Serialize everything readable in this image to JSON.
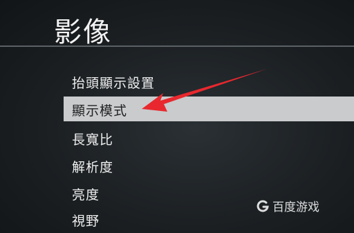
{
  "header": {
    "title": "影像"
  },
  "menu": {
    "items": [
      {
        "label": "抬頭顯示設置",
        "selected": false
      },
      {
        "label": "顯示模式",
        "selected": true
      },
      {
        "label": "長寬比",
        "selected": false
      },
      {
        "label": "解析度",
        "selected": false
      },
      {
        "label": "亮度",
        "selected": false
      },
      {
        "label": "視野",
        "selected": false
      }
    ]
  },
  "annotation": {
    "color": "#e8282e"
  },
  "watermark": {
    "text": "百度游戏",
    "icon": "baidu-game-logo-icon"
  }
}
